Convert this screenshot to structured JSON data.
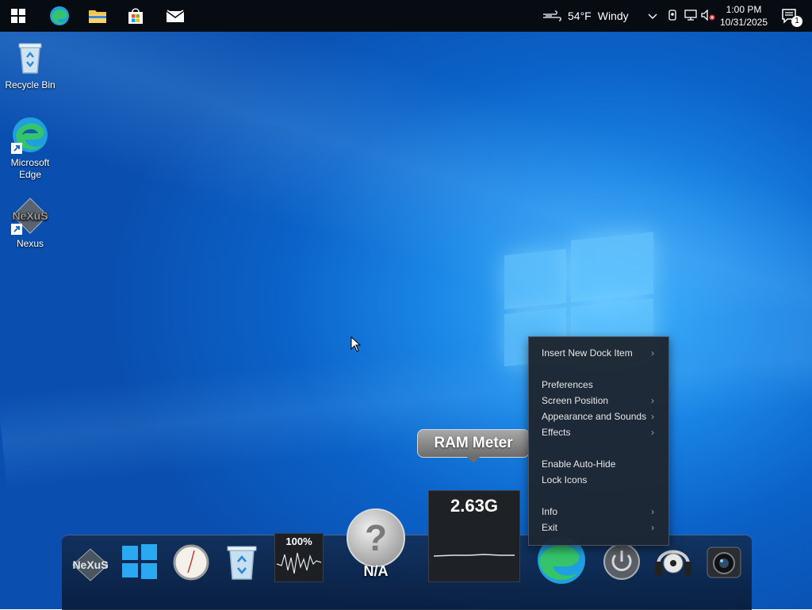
{
  "taskbar": {
    "weather": {
      "temp": "54°F",
      "condition": "Windy"
    },
    "clock": {
      "time": "1:00 PM",
      "date": "10/31/2025"
    },
    "notification_count": "1",
    "pinned": [
      "windows-start",
      "microsoft-edge",
      "file-explorer",
      "microsoft-store",
      "mail"
    ]
  },
  "desktop_icons": [
    {
      "label": "Recycle Bin"
    },
    {
      "label": "Microsoft Edge"
    },
    {
      "label": "Nexus"
    }
  ],
  "context_menu": {
    "items": [
      {
        "label": "Insert New Dock Item",
        "submenu": true
      },
      {
        "label": "Preferences",
        "submenu": false
      },
      {
        "label": "Screen Position",
        "submenu": true
      },
      {
        "label": "Appearance and Sounds",
        "submenu": true
      },
      {
        "label": "Effects",
        "submenu": true
      },
      {
        "label": "Enable Auto-Hide",
        "submenu": false
      },
      {
        "label": "Lock Icons",
        "submenu": false
      },
      {
        "label": "Info",
        "submenu": true
      },
      {
        "label": "Exit",
        "submenu": true
      }
    ],
    "arrow_glyph": "›"
  },
  "tooltip": {
    "label": "RAM Meter"
  },
  "ram_meter": {
    "value": "2.63G"
  },
  "dock": {
    "cpu_meter": {
      "value": "100%"
    },
    "unknown_item": {
      "label": "N/A"
    },
    "items": [
      "nexus-logo",
      "windows-logo",
      "clock",
      "recycle-bin",
      "cpu-meter",
      "unknown",
      "ram-meter",
      "microsoft-edge",
      "power",
      "media-player",
      "camera"
    ]
  },
  "colors": {
    "taskbar_bg": "#070b12",
    "menu_bg": "#1e2632",
    "desktop_accent": "#1a86e6"
  }
}
